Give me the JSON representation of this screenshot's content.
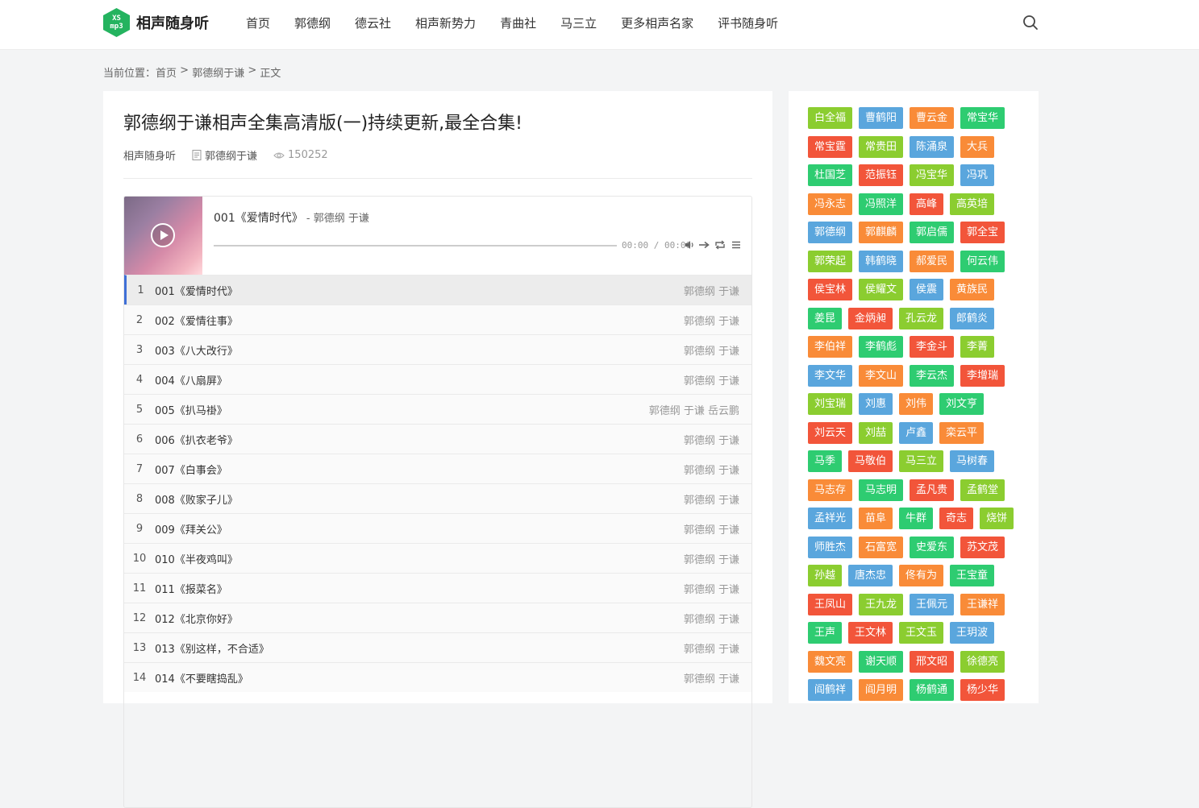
{
  "header": {
    "logo_badge_top": "XS",
    "logo_badge_bottom": "mp3",
    "site_name": "相声随身听",
    "nav": [
      "首页",
      "郭德纲",
      "德云社",
      "相声新势力",
      "青曲社",
      "马三立",
      "更多相声名家",
      "评书随身听"
    ]
  },
  "breadcrumb": {
    "prefix": "当前位置：",
    "home": "首页",
    "sep1": " > ",
    "category": "郭德纲于谦",
    "sep2": " > ",
    "current": "正文"
  },
  "post": {
    "title": "郭德纲于谦相声全集高清版(一)持续更新,最全合集!",
    "site": "相声随身听",
    "category": "郭德纲于谦",
    "views": "150252"
  },
  "player": {
    "track": "001《爱情时代》",
    "author": " - 郭德纲 于谦",
    "time": "00:00 / 00:00",
    "progress": 0
  },
  "playlist": [
    {
      "idx": "1",
      "name": "001《爱情时代》",
      "artist": "郭德纲 于谦"
    },
    {
      "idx": "2",
      "name": "002《爱情往事》",
      "artist": "郭德纲 于谦"
    },
    {
      "idx": "3",
      "name": "003《八大改行》",
      "artist": "郭德纲 于谦"
    },
    {
      "idx": "4",
      "name": "004《八扇屏》",
      "artist": "郭德纲 于谦"
    },
    {
      "idx": "5",
      "name": "005《扒马褂》",
      "artist": "郭德纲 于谦 岳云鹏"
    },
    {
      "idx": "6",
      "name": "006《扒衣老爷》",
      "artist": "郭德纲 于谦"
    },
    {
      "idx": "7",
      "name": "007《白事会》",
      "artist": "郭德纲 于谦"
    },
    {
      "idx": "8",
      "name": "008《败家子儿》",
      "artist": "郭德纲 于谦"
    },
    {
      "idx": "9",
      "name": "009《拜关公》",
      "artist": "郭德纲 于谦"
    },
    {
      "idx": "10",
      "name": "010《半夜鸡叫》",
      "artist": "郭德纲 于谦"
    },
    {
      "idx": "11",
      "name": "011《报菜名》",
      "artist": "郭德纲 于谦"
    },
    {
      "idx": "12",
      "name": "012《北京你好》",
      "artist": "郭德纲 于谦"
    },
    {
      "idx": "13",
      "name": "013《别这样，不合适》",
      "artist": "郭德纲 于谦"
    },
    {
      "idx": "14",
      "name": "014《不要瞎捣乱》",
      "artist": "郭德纲 于谦"
    }
  ],
  "tag_colors": {
    "green": "#8bcd30",
    "blue": "#5aa6dd",
    "orange": "#f98b38",
    "red": "#f2553a",
    "bright": "#2ecc71"
  },
  "tags": [
    [
      {
        "t": "白全福",
        "c": "green"
      },
      {
        "t": "曹鹤阳",
        "c": "blue"
      },
      {
        "t": "曹云金",
        "c": "orange"
      },
      {
        "t": "常宝华",
        "c": "bright"
      }
    ],
    [
      {
        "t": "常宝霆",
        "c": "red"
      },
      {
        "t": "常贵田",
        "c": "green"
      },
      {
        "t": "陈涌泉",
        "c": "blue"
      },
      {
        "t": "大兵",
        "c": "orange"
      }
    ],
    [
      {
        "t": "杜国芝",
        "c": "bright"
      },
      {
        "t": "范振钰",
        "c": "red"
      },
      {
        "t": "冯宝华",
        "c": "green"
      },
      {
        "t": "冯巩",
        "c": "blue"
      }
    ],
    [
      {
        "t": "冯永志",
        "c": "orange"
      },
      {
        "t": "冯照洋",
        "c": "bright"
      },
      {
        "t": "高峰",
        "c": "red"
      },
      {
        "t": "高英培",
        "c": "green"
      }
    ],
    [
      {
        "t": "郭德纲",
        "c": "blue"
      },
      {
        "t": "郭麒麟",
        "c": "orange"
      },
      {
        "t": "郭启儒",
        "c": "bright"
      },
      {
        "t": "郭全宝",
        "c": "red"
      }
    ],
    [
      {
        "t": "郭荣起",
        "c": "green"
      },
      {
        "t": "韩鹤晓",
        "c": "blue"
      },
      {
        "t": "郝爱民",
        "c": "orange"
      },
      {
        "t": "何云伟",
        "c": "bright"
      }
    ],
    [
      {
        "t": "侯宝林",
        "c": "red"
      },
      {
        "t": "侯耀文",
        "c": "green"
      },
      {
        "t": "侯震",
        "c": "blue"
      },
      {
        "t": "黄族民",
        "c": "orange"
      }
    ],
    [
      {
        "t": "姜昆",
        "c": "bright"
      },
      {
        "t": "金炳昶",
        "c": "red"
      },
      {
        "t": "孔云龙",
        "c": "green"
      },
      {
        "t": "郎鹤炎",
        "c": "blue"
      }
    ],
    [
      {
        "t": "李伯祥",
        "c": "orange"
      },
      {
        "t": "李鹤彪",
        "c": "bright"
      },
      {
        "t": "李金斗",
        "c": "red"
      },
      {
        "t": "李菁",
        "c": "green"
      }
    ],
    [
      {
        "t": "李文华",
        "c": "blue"
      },
      {
        "t": "李文山",
        "c": "orange"
      },
      {
        "t": "李云杰",
        "c": "bright"
      },
      {
        "t": "李增瑞",
        "c": "red"
      }
    ],
    [
      {
        "t": "刘宝瑞",
        "c": "green"
      },
      {
        "t": "刘惠",
        "c": "blue"
      },
      {
        "t": "刘伟",
        "c": "orange"
      },
      {
        "t": "刘文亨",
        "c": "bright"
      }
    ],
    [
      {
        "t": "刘云天",
        "c": "red"
      },
      {
        "t": "刘喆",
        "c": "green"
      },
      {
        "t": "卢鑫",
        "c": "blue"
      },
      {
        "t": "栾云平",
        "c": "orange"
      }
    ],
    [
      {
        "t": "马季",
        "c": "bright"
      },
      {
        "t": "马敬伯",
        "c": "red"
      },
      {
        "t": "马三立",
        "c": "green"
      },
      {
        "t": "马树春",
        "c": "blue"
      }
    ],
    [
      {
        "t": "马志存",
        "c": "orange"
      },
      {
        "t": "马志明",
        "c": "bright"
      },
      {
        "t": "孟凡贵",
        "c": "red"
      },
      {
        "t": "孟鹤堂",
        "c": "green"
      }
    ],
    [
      {
        "t": "孟祥光",
        "c": "blue"
      },
      {
        "t": "苗阜",
        "c": "orange"
      },
      {
        "t": "牛群",
        "c": "bright"
      },
      {
        "t": "奇志",
        "c": "red"
      },
      {
        "t": "烧饼",
        "c": "green"
      }
    ],
    [
      {
        "t": "师胜杰",
        "c": "blue"
      },
      {
        "t": "石富宽",
        "c": "orange"
      },
      {
        "t": "史爱东",
        "c": "bright"
      },
      {
        "t": "苏文茂",
        "c": "red"
      }
    ],
    [
      {
        "t": "孙越",
        "c": "green"
      },
      {
        "t": "唐杰忠",
        "c": "blue"
      },
      {
        "t": "佟有为",
        "c": "orange"
      },
      {
        "t": "王宝童",
        "c": "bright"
      }
    ],
    [
      {
        "t": "王凤山",
        "c": "red"
      },
      {
        "t": "王九龙",
        "c": "green"
      },
      {
        "t": "王佩元",
        "c": "blue"
      },
      {
        "t": "王谦祥",
        "c": "orange"
      }
    ],
    [
      {
        "t": "王声",
        "c": "bright"
      },
      {
        "t": "王文林",
        "c": "red"
      },
      {
        "t": "王文玉",
        "c": "green"
      },
      {
        "t": "王玥波",
        "c": "blue"
      }
    ],
    [
      {
        "t": "魏文亮",
        "c": "orange"
      },
      {
        "t": "谢天顺",
        "c": "bright"
      },
      {
        "t": "邢文昭",
        "c": "red"
      },
      {
        "t": "徐德亮",
        "c": "green"
      }
    ],
    [
      {
        "t": "阎鹤祥",
        "c": "blue"
      },
      {
        "t": "阎月明",
        "c": "orange"
      },
      {
        "t": "杨鹤通",
        "c": "bright"
      },
      {
        "t": "杨少华",
        "c": "red"
      }
    ]
  ]
}
